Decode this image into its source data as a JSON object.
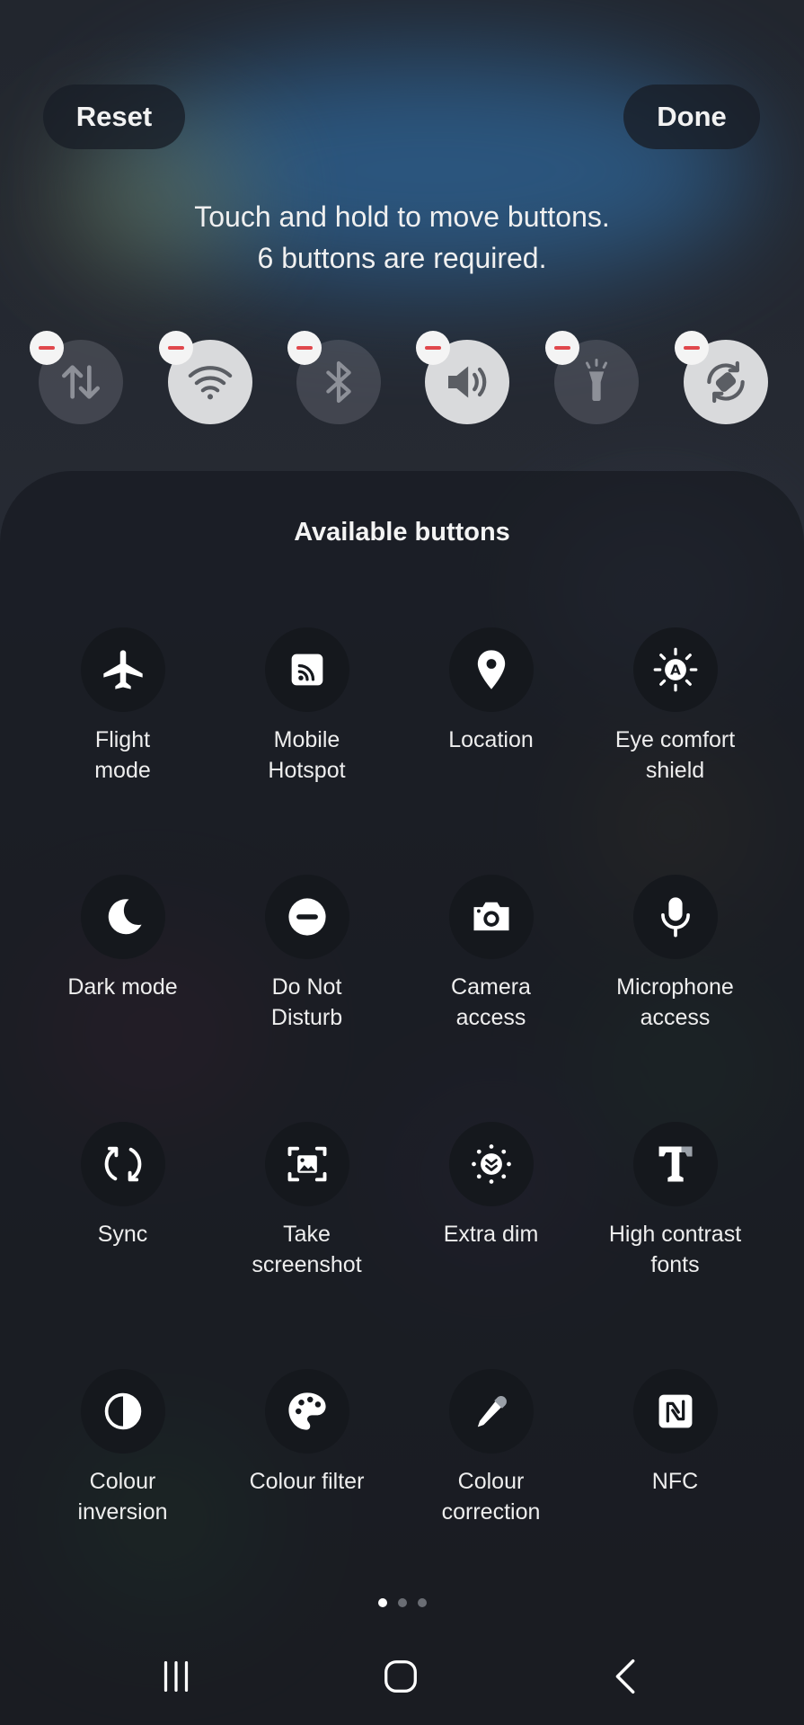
{
  "header": {
    "reset_label": "Reset",
    "done_label": "Done",
    "hint_line1": "Touch and hold to move buttons.",
    "hint_line2": "6 buttons are required."
  },
  "active_buttons": [
    {
      "icon": "mobile-data-icon",
      "state": "off"
    },
    {
      "icon": "wifi-icon",
      "state": "on"
    },
    {
      "icon": "bluetooth-icon",
      "state": "off"
    },
    {
      "icon": "sound-icon",
      "state": "on"
    },
    {
      "icon": "flashlight-icon",
      "state": "off"
    },
    {
      "icon": "auto-rotate-icon",
      "state": "on"
    }
  ],
  "available": {
    "title": "Available buttons",
    "items": [
      {
        "label": "Flight\nmode",
        "icon": "airplane-icon"
      },
      {
        "label": "Mobile\nHotspot",
        "icon": "hotspot-icon"
      },
      {
        "label": "Location",
        "icon": "location-pin-icon"
      },
      {
        "label": "Eye comfort\nshield",
        "icon": "eye-comfort-icon"
      },
      {
        "label": "Dark mode",
        "icon": "moon-icon"
      },
      {
        "label": "Do Not\nDisturb",
        "icon": "do-not-disturb-icon"
      },
      {
        "label": "Camera\naccess",
        "icon": "camera-icon"
      },
      {
        "label": "Microphone\naccess",
        "icon": "microphone-icon"
      },
      {
        "label": "Sync",
        "icon": "sync-icon"
      },
      {
        "label": "Take\nscreenshot",
        "icon": "screenshot-icon"
      },
      {
        "label": "Extra dim",
        "icon": "extra-dim-icon"
      },
      {
        "label": "High contrast\nfonts",
        "icon": "high-contrast-font-icon"
      },
      {
        "label": "Colour\ninversion",
        "icon": "colour-inversion-icon"
      },
      {
        "label": "Colour filter",
        "icon": "palette-icon"
      },
      {
        "label": "Colour\ncorrection",
        "icon": "eyedropper-icon"
      },
      {
        "label": "NFC",
        "icon": "nfc-icon"
      }
    ]
  },
  "pager": {
    "pages": 3,
    "current": 0
  },
  "colors": {
    "accent_remove": "#e0474c",
    "tile_on": "#d9dadc"
  }
}
